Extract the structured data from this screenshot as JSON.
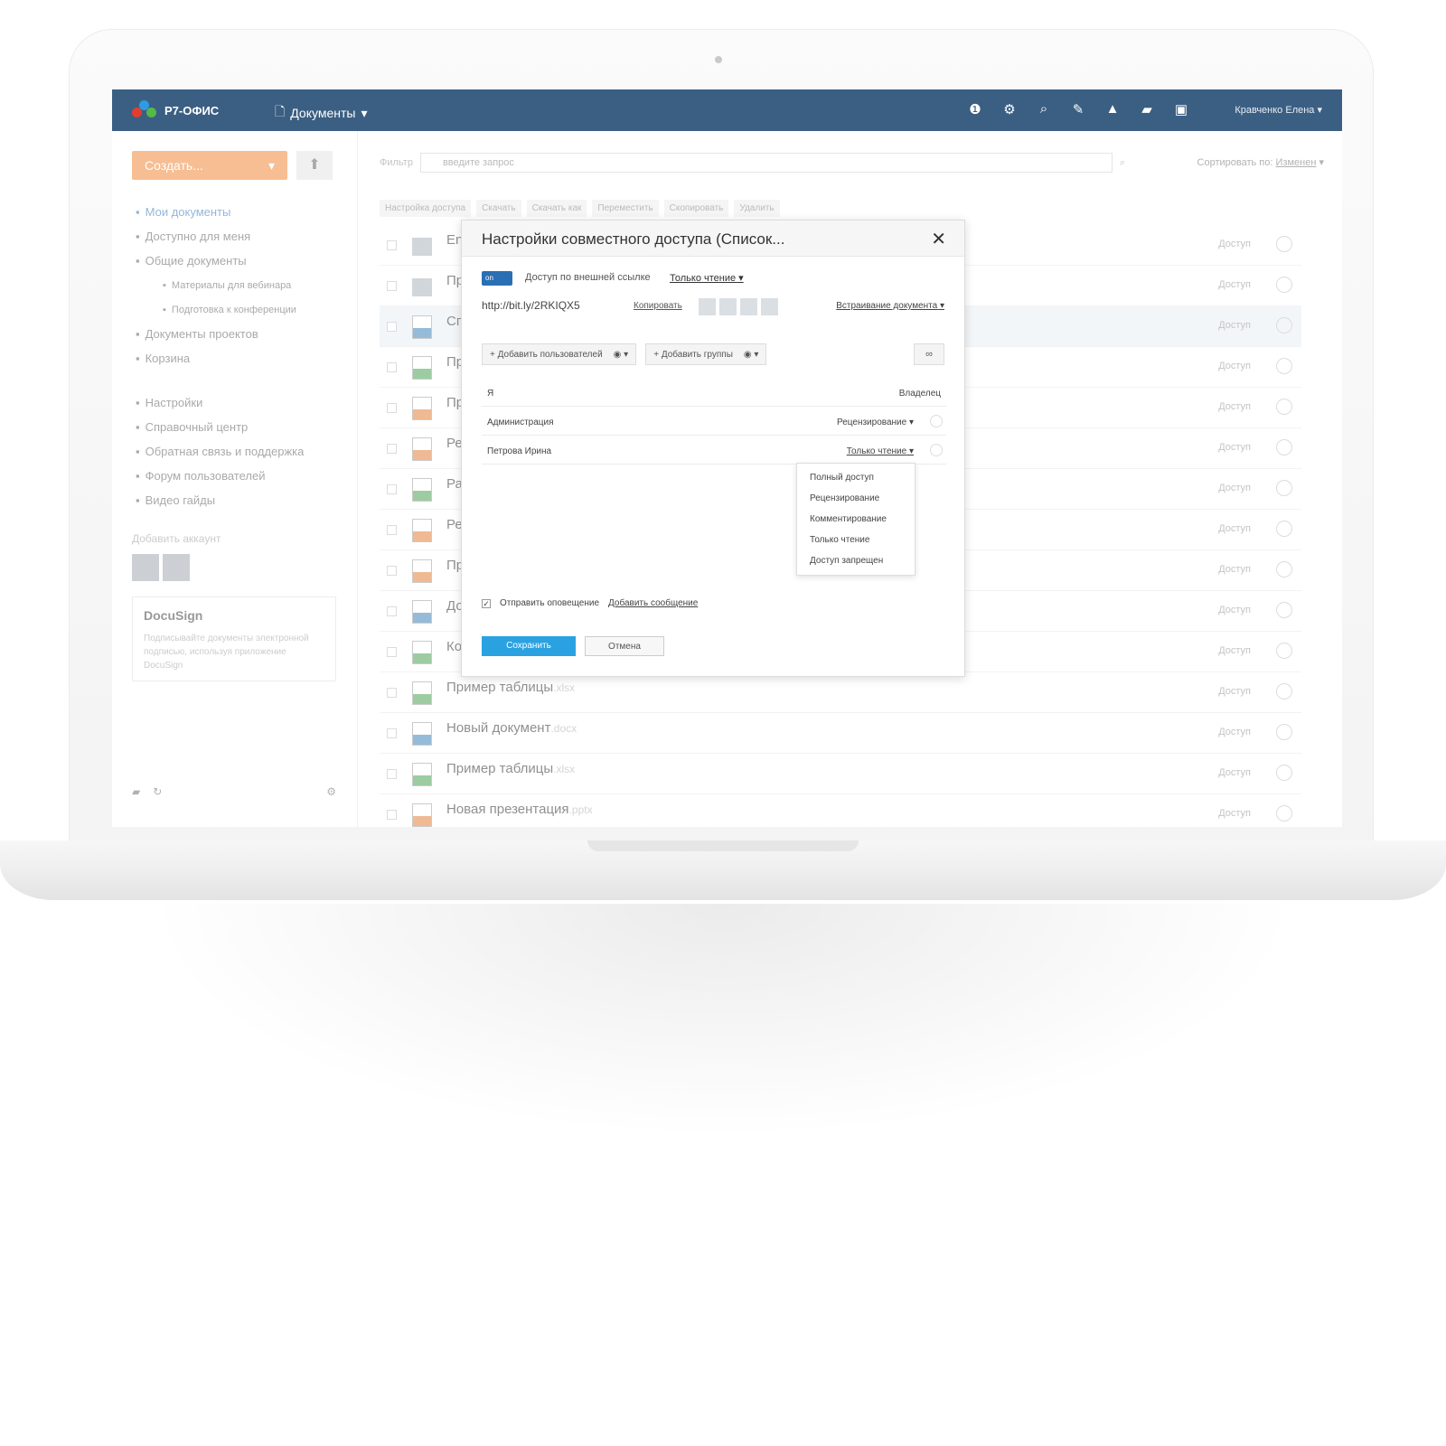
{
  "app": {
    "logo_text": "Р7-ОФИС",
    "module": "Документы",
    "user": "Кравченко Елена",
    "colors": {
      "topbar": "#3b5f82",
      "create": "#f07f2a",
      "accent": "#2a6fb3",
      "save": "#2aa2e2"
    }
  },
  "sidebar": {
    "create_label": "Создать...",
    "items": [
      {
        "label": "Мои документы",
        "icon": "user-icon",
        "level": 0
      },
      {
        "label": "Доступно для меня",
        "icon": "share-icon",
        "level": 0
      },
      {
        "label": "Общие документы",
        "icon": "stack-icon",
        "level": 0
      },
      {
        "label": "Материалы для вебинара",
        "icon": "folder-icon",
        "level": 1
      },
      {
        "label": "Подготовка к конференции",
        "icon": "folder-icon",
        "level": 1
      },
      {
        "label": "Документы проектов",
        "icon": "projects-icon",
        "level": 0
      },
      {
        "label": "Корзина",
        "icon": "trash-icon",
        "level": 0
      },
      {
        "label": "Настройки",
        "icon": "gear-icon",
        "level": 0
      },
      {
        "label": "Справочный центр",
        "icon": "help-icon",
        "level": 0
      },
      {
        "label": "Обратная связь и поддержка",
        "icon": "megaphone-icon",
        "level": 0
      },
      {
        "label": "Форум пользователей",
        "icon": "chat-icon",
        "level": 0
      },
      {
        "label": "Видео гайды",
        "icon": "video-icon",
        "level": 0
      }
    ],
    "add_account": "Добавить аккаунт",
    "docusign_title": "DocuSign",
    "docusign_text": "Подписывайте документы электронной подписью, используя приложение DocuSign"
  },
  "toolbar": {
    "filter_label": "Фильтр",
    "filter_placeholder": "введите запрос",
    "sort_label": "Сортировать по:",
    "sort_value": "Изменен",
    "actions": [
      "Настройка доступа",
      "Скачать",
      "Скачать как",
      "Переместить",
      "Скопировать",
      "Удалить"
    ]
  },
  "files": [
    {
      "name": "En",
      "ext": "",
      "meta": "",
      "type": "folder",
      "access": "Доступ",
      "selected": false
    },
    {
      "name": "Пр",
      "ext": "",
      "meta": "",
      "type": "folder",
      "access": "Доступ",
      "selected": false
    },
    {
      "name": "Сп",
      "ext": "",
      "meta": "",
      "type": "doc",
      "access": "Доступ",
      "selected": true
    },
    {
      "name": "Пр",
      "ext": "",
      "meta": "",
      "type": "xls",
      "access": "Доступ",
      "selected": false
    },
    {
      "name": "Пр",
      "ext": "",
      "meta": "",
      "type": "ppt",
      "access": "Доступ",
      "selected": false
    },
    {
      "name": "Ре",
      "ext": "",
      "meta": "",
      "type": "ppt",
      "access": "Доступ",
      "selected": false
    },
    {
      "name": "Ра",
      "ext": "",
      "meta": "",
      "type": "xls",
      "access": "Доступ",
      "selected": false
    },
    {
      "name": "Ре",
      "ext": "",
      "meta": "",
      "type": "ppt",
      "access": "Доступ",
      "selected": false
    },
    {
      "name": "Пр",
      "ext": "",
      "meta": "",
      "type": "ppt",
      "access": "Доступ",
      "selected": false
    },
    {
      "name": "До",
      "ext": "",
      "meta": "",
      "type": "doc",
      "access": "Доступ",
      "selected": false
    },
    {
      "name": "Ко",
      "ext": "",
      "meta": "",
      "type": "xls",
      "access": "Доступ",
      "selected": false
    },
    {
      "name": "Пример таблицы",
      "ext": ".xlsx",
      "meta": "",
      "type": "xls",
      "access": "Доступ",
      "selected": false
    },
    {
      "name": "Новый документ",
      "ext": ".docx",
      "meta": "",
      "type": "doc",
      "access": "Доступ",
      "selected": false
    },
    {
      "name": "Пример таблицы",
      "ext": ".xlsx",
      "meta": "",
      "type": "xls",
      "access": "Доступ",
      "selected": false
    },
    {
      "name": "Новая презентация",
      "ext": ".pptx",
      "meta": "",
      "type": "ppt",
      "access": "Доступ",
      "selected": false
    }
  ],
  "dialog": {
    "title": "Настройки совместного доступа (Список...",
    "external_label": "Доступ по внешней ссылке",
    "external_mode": "Только чтение",
    "link": "http://bit.ly/2RKIQX5",
    "copy_label": "Копировать",
    "embed_label": "Встраивание документа",
    "add_users": "Добавить пользователей",
    "add_groups": "Добавить группы",
    "owner_label": "Владелец",
    "users": [
      {
        "name": "Администрация",
        "right": "Рецензирование"
      },
      {
        "name": "Петрова Ирина",
        "right": "Только чтение"
      }
    ],
    "rights_menu": [
      "Полный доступ",
      "Рецензирование",
      "Комментирование",
      "Только чтение",
      "Доступ запрещен"
    ],
    "notify_label": "Отправить оповещение",
    "add_message": "Добавить сообщение",
    "save_label": "Сохранить",
    "cancel_label": "Отмена"
  }
}
